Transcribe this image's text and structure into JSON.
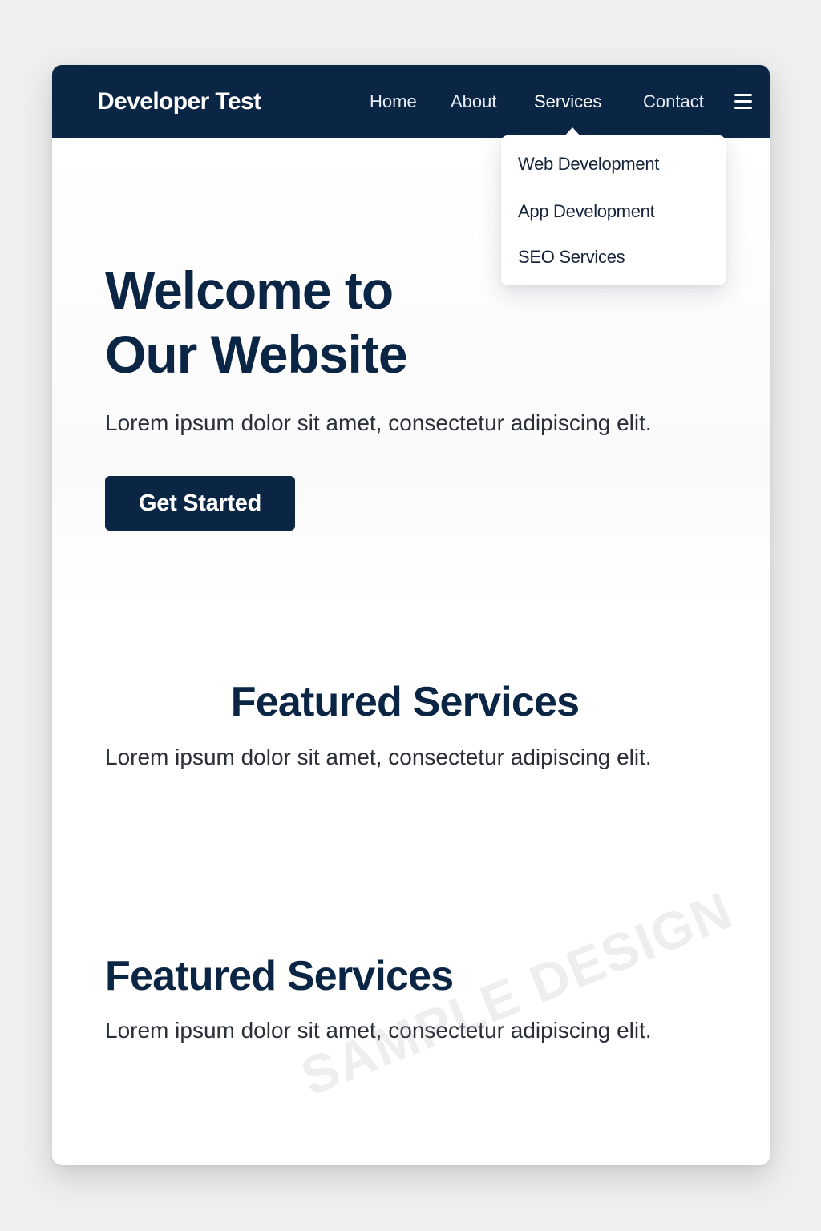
{
  "header": {
    "brand": "Developer Test",
    "nav": {
      "home": "Home",
      "about": "About",
      "services": "Services",
      "contact": "Contact"
    },
    "menu_icon": "hamburger-menu-icon"
  },
  "dropdown": {
    "items": [
      "Web Development",
      "App Development",
      "SEO Services"
    ]
  },
  "hero": {
    "title_line1": "Welcome to",
    "title_line2": "Our Website",
    "text": "Lorem ipsum dolor sit amet, consectetur adipiscing elit.",
    "cta_label": "Get Started"
  },
  "sections": [
    {
      "title": "Featured Services",
      "text": "Lorem ipsum dolor sit amet, consectetur adipiscing elit."
    },
    {
      "title": "Featured Services",
      "text": "Lorem ipsum dolor sit amet, consectetur adipiscing elit."
    }
  ],
  "watermark": "SAMPLE DESIGN",
  "colors": {
    "navy": "#0b2545",
    "page_bg": "#efefef",
    "card_bg": "#ffffff",
    "body_text": "#2a2f38"
  }
}
